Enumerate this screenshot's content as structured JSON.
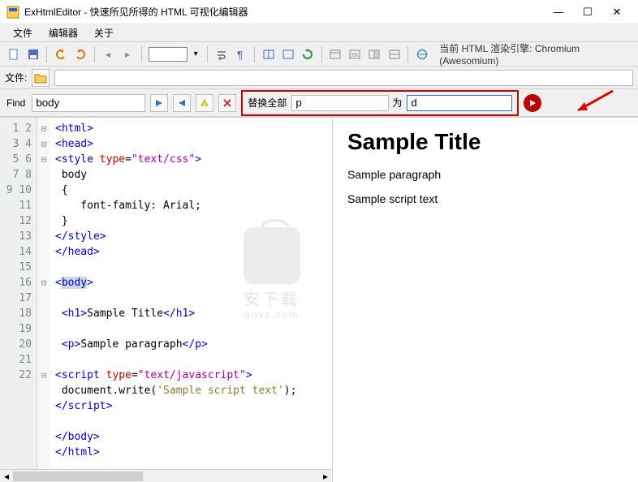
{
  "window": {
    "title": "ExHtmlEditor - 快速所见所得的 HTML 可视化编辑器"
  },
  "menu": {
    "file": "文件",
    "editor": "编辑器",
    "about": "关于"
  },
  "toolbar": {
    "status": "当前 HTML 渲染引擎:  Chromium (Awesomium)"
  },
  "filebar": {
    "label": "文件:"
  },
  "find": {
    "label": "Find",
    "value": "body",
    "replace_all": "替换全部",
    "replace_from": "p",
    "replace_to_label": "为",
    "replace_to": "d"
  },
  "code": {
    "lines": [
      "1",
      "2",
      "3",
      "4",
      "5",
      "6",
      "7",
      "8",
      "9",
      "10",
      "11",
      "12",
      "13",
      "14",
      "15",
      "16",
      "17",
      "18",
      "19",
      "20",
      "21",
      "22"
    ]
  },
  "preview": {
    "title": "Sample Title",
    "para": "Sample paragraph",
    "script_text": "Sample script text"
  },
  "watermark": {
    "line1": "安下载",
    "line2": "anxz.com"
  }
}
